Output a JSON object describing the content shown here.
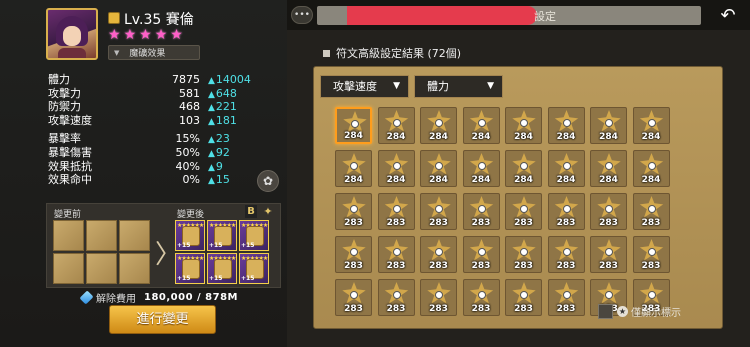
{
  "monster": {
    "level_text": "Lv.35 賽倫",
    "stars": [
      "★",
      "★",
      "★",
      "★",
      "★"
    ],
    "magic_button": "魔礦效果",
    "stats": [
      {
        "label": "體力",
        "value": "7875",
        "bonus": "14004"
      },
      {
        "label": "攻擊力",
        "value": "581",
        "bonus": "648"
      },
      {
        "label": "防禦力",
        "value": "468",
        "bonus": "221"
      },
      {
        "label": "攻擊速度",
        "value": "103",
        "bonus": "181"
      },
      {
        "label": "暴擊率",
        "value": "15%",
        "bonus": "23"
      },
      {
        "label": "暴擊傷害",
        "value": "50%",
        "bonus": "92"
      },
      {
        "label": "效果抵抗",
        "value": "40%",
        "bonus": "9"
      },
      {
        "label": "效果命中",
        "value": "0%",
        "bonus": "15"
      }
    ]
  },
  "change": {
    "before_label": "變更前",
    "after_label": "變更後",
    "b_icon": "B",
    "after_slots": [
      "+15",
      "+15",
      "+15",
      "+15",
      "+15",
      "+15"
    ],
    "cost_label": "解除費用",
    "cost_value": "180,000 / 878M",
    "confirm_button": "進行變更"
  },
  "header": {
    "title_visible_fragment": "設定",
    "back_icon": "↶"
  },
  "results": {
    "title": "符文高級設定結果 (72個)",
    "filter1": "攻擊速度",
    "filter2": "體力",
    "cells": [
      "284",
      "284",
      "284",
      "284",
      "284",
      "284",
      "284",
      "284",
      "284",
      "284",
      "284",
      "284",
      "284",
      "284",
      "284",
      "284",
      "283",
      "283",
      "283",
      "283",
      "283",
      "283",
      "283",
      "283",
      "283",
      "283",
      "283",
      "283",
      "283",
      "283",
      "283",
      "283",
      "283",
      "283",
      "283",
      "283",
      "283",
      "283",
      "283",
      "283"
    ],
    "selected_index": 0,
    "show_label": "僅顯示標示"
  },
  "colors": {
    "bonus": "#4fe0e6",
    "star": "#ff5fc8",
    "confirm": "#e3a431",
    "board": "#b99a5c",
    "selection": "#ff9d1c"
  }
}
